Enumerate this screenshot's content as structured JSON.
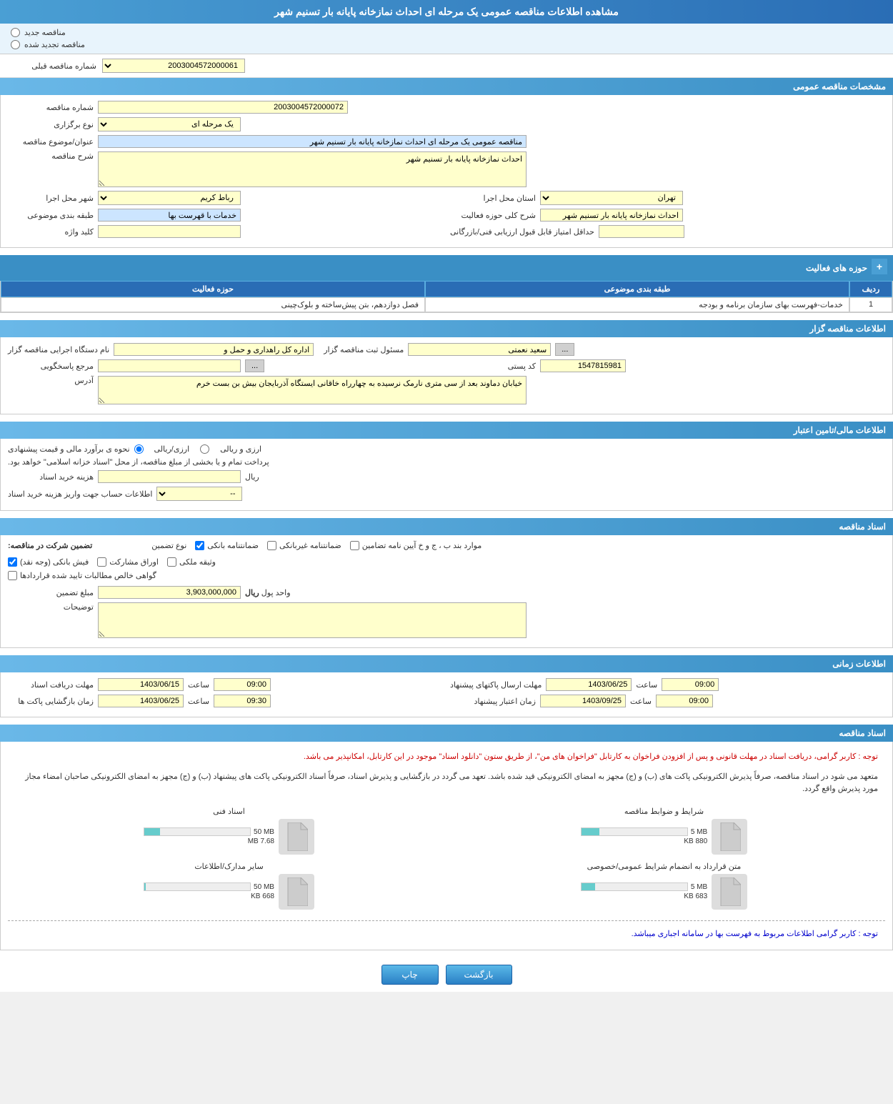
{
  "page": {
    "title": "مشاهده اطلاعات مناقصه عمومی یک مرحله ای احداث نمازخانه پایانه بار تسنیم شهر"
  },
  "top_radio": {
    "option1": "مناقصه جدید",
    "option2": "مناقصه تجدید شده"
  },
  "prev_tender_label": "شماره مناقصه قبلی",
  "prev_tender_value": "2003004572000061",
  "sections": {
    "general": {
      "title": "مشخصات مناقصه عمومی",
      "tender_number_label": "شماره مناقصه",
      "tender_number_value": "2003004572000072",
      "type_label": "نوع برگزاری",
      "type_value": "یک مرحله ای",
      "subject_label": "عنوان/موضوع مناقصه",
      "subject_value": "مناقصه عمومی یک مرحله ای احداث نمازخانه پایانه بار تسنیم شهر",
      "description_label": "شرح مناقصه",
      "description_value": "احداث نمازخانه پایانه بار تسنیم شهر",
      "province_label": "استان محل اجرا",
      "province_value": "تهران",
      "city_label": "شهر محل اجرا",
      "city_value": "رباط کریم",
      "category_label": "طبقه بندی موضوعی",
      "category_value": "خدمات با قهرست بها",
      "activity_desc_label": "شرح کلی حوزه فعالیت",
      "activity_desc_value": "احداث نمازخانه پایانه بار تسنیم شهر",
      "key_label": "کلید واژه",
      "key_value": "",
      "min_score_label": "حداقل امتیاز قابل قبول ارزیابی فنی/بازرگانی",
      "min_score_value": ""
    },
    "activity_table": {
      "title": "حوزه های فعالیت",
      "headers": [
        "ردیف",
        "طبقه بندی موضوعی",
        "حوزه فعالیت"
      ],
      "rows": [
        [
          "1",
          "خدمات-فهرست بهای سازمان برنامه و بودجه",
          "فصل دوازدهم، بتن پیش‌ساخته و بلوک‌چینی"
        ]
      ]
    },
    "contractor": {
      "title": "اطلاعات مناقصه گزار",
      "org_label": "نام دستگاه اجرایی مناقصه گزار",
      "org_value": "اداره کل راهداری و حمل و",
      "responsible_label": "مسئول ثبت مناقصه گزار",
      "responsible_value": "سعید نعمتی",
      "reference_label": "مرجع پاسخگویی",
      "reference_value": "",
      "postal_label": "کد پستی",
      "postal_value": "1547815981",
      "address_label": "آدرس",
      "address_value": "خیابان دماوند بعد از سی متری نارمک نرسیده به چهارراه خاقانی ایستگاه آذربایجان بیش بن بست خرم"
    },
    "finance": {
      "title": "اطلاعات مالی/تامین اعتبار",
      "estimate_label": "نحوه ی برآورد مالی و قیمت پیشنهادی",
      "radio_ryal": "ارزی/ریالی",
      "radio_currency": "ارزی و ریالی",
      "payment_note": "پرداخت تمام و یا بخشی از مبلغ مناقصه، از محل \"اسناد خزانه اسلامی\" خواهد بود.",
      "doc_cost_label": "هزینه خرید اسناد",
      "doc_cost_value": "ریال",
      "account_label": "اطلاعات حساب جهت واریز هزینه خرید اسناد",
      "account_value": "--"
    },
    "guarantee": {
      "title": "اسناد مناقصه",
      "guarantee_label": "تضمین شرکت در مناقصه:",
      "guarantee_type_label": "نوع تضمین",
      "checkboxes": [
        {
          "label": "ضمانتنامه غیربانکی",
          "checked": false
        },
        {
          "label": "ضمانتنامه بانکی",
          "checked": true
        },
        {
          "label": "موارد بند ب، ج و خ آیین نامه تضامین",
          "checked": false
        },
        {
          "label": "فیش بانکی (وجه نقد)",
          "checked": true
        },
        {
          "label": "اوراق مشارکت",
          "checked": false
        },
        {
          "label": "وثیقه ملکی",
          "checked": false
        },
        {
          "label": "گواهی خالص مطالبات تایید شده قراردادها",
          "checked": false
        }
      ],
      "amount_label": "مبلغ تضمین",
      "amount_value": "3,903,000,000",
      "unit_label": "واحد پول",
      "unit_value": "ریال",
      "description_label": "توضیحات",
      "description_value": ""
    },
    "timing": {
      "title": "اطلاعات زمانی",
      "receive_doc_label": "مهلت دریافت اسناد",
      "receive_doc_date": "1403/06/15",
      "receive_doc_time": "09:00",
      "send_offer_label": "مهلت ارسال پاکتهای پیشنهاد",
      "send_offer_date": "1403/06/25",
      "send_offer_time": "09:00",
      "open_offer_label": "زمان بازگشایی پاکت ها",
      "open_offer_date": "1403/06/25",
      "open_offer_time": "09:30",
      "validity_label": "زمان اعتبار پیشنهاد",
      "validity_date": "1403/09/25",
      "validity_time": "09:00"
    },
    "documents": {
      "title": "اسناد مناقصه",
      "notice1": "توجه : کاربر گرامی، دریافت اسناد در مهلت قانونی و پس از افزودن فراخوان به کارتابل \"فراخوان های من\"، از طریق ستون \"دانلود اسناد\" موجود در این کارتابل، امکانپذیر می باشد.",
      "notice2": "متعهد می شود در اسناد مناقصه، صرفاً پذیرش الکترونیکی پاکت های (ب) و (ج) مجهز به امضای الکترونیکی قید شده باشد. تعهد می گردد در بازگشایی و پذیرش اسناد، صرفاً اسناد الکترونیکی پاکت های پیشنهاد (ب) و (ج) مجهز به امضای الکترونیکی صاحبان امضاء مجاز مورد پذیرش واقع گردد.",
      "files": [
        {
          "name": "شرایط و ضوابط مناقصه",
          "current": 880,
          "current_unit": "KB",
          "max": 5,
          "max_unit": "MB",
          "percent": 17
        },
        {
          "name": "اسناد فنی",
          "current": 7.68,
          "current_unit": "MB",
          "max": 50,
          "max_unit": "MB",
          "percent": 15
        },
        {
          "name": "متن قرارداد به انضمام شرایط عمومی/خصوصی",
          "current": 683,
          "current_unit": "KB",
          "max": 5,
          "max_unit": "MB",
          "percent": 13
        },
        {
          "name": "سایر مدارک/اطلاعات",
          "current": 668,
          "current_unit": "KB",
          "max": 50,
          "max_unit": "MB",
          "percent": 1
        }
      ],
      "notice3": "توجه : کاربر گرامی اطلاعات مربوط به فهرست بها در سامانه اجباری میباشد."
    }
  },
  "buttons": {
    "print": "چاپ",
    "back": "بازگشت"
  }
}
